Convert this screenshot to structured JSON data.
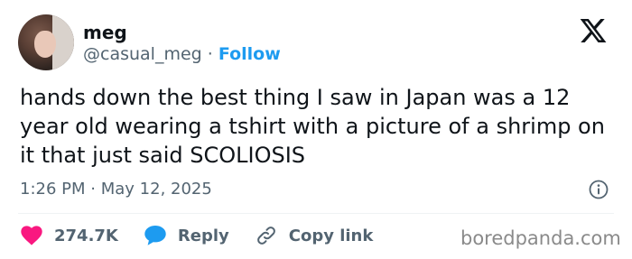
{
  "user": {
    "name": "meg",
    "handle": "@casual_meg",
    "separator": "·",
    "follow_label": "Follow"
  },
  "tweet": {
    "text": "hands down the best thing I saw in Japan was a 12 year old wearing a tshirt with a picture of a shrimp on it that just said SCOLIOSIS",
    "time": "1:26 PM",
    "separator": "·",
    "date": "May 12, 2025"
  },
  "actions": {
    "like_count": "274.7K",
    "reply_label": "Reply",
    "copy_label": "Copy link"
  },
  "icons": {
    "logo": "x-logo-icon",
    "info": "info-icon",
    "like": "heart-icon",
    "reply": "speech-bubble-icon",
    "copy": "link-icon"
  },
  "colors": {
    "like": "#f91880",
    "reply": "#1d9bf0",
    "follow": "#1d9bf0",
    "secondary_text": "#536471"
  },
  "watermark": "boredpanda.com"
}
